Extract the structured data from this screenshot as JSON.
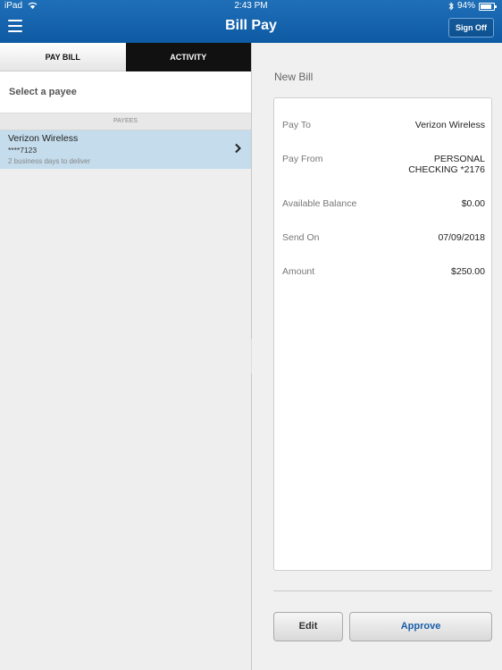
{
  "status_bar": {
    "device": "iPad",
    "time": "2:43 PM",
    "battery": "94%"
  },
  "header": {
    "title": "Bill Pay",
    "sign_off_label": "Sign Off"
  },
  "left_pane": {
    "tabs": [
      {
        "label": "PAY BILL"
      },
      {
        "label": "ACTIVITY"
      }
    ],
    "select_payee": "Select a payee",
    "payees_header": "PAYEES",
    "payees": [
      {
        "name": "Verizon Wireless",
        "account": "****7123",
        "delivery": "2 business days to deliver"
      }
    ]
  },
  "right_pane": {
    "title": "New Bill",
    "fields": [
      {
        "label": "Pay To",
        "value": "Verizon Wireless"
      },
      {
        "label": "Pay From",
        "value": "PERSONAL CHECKING *2176"
      },
      {
        "label": "Available Balance",
        "value": "$0.00"
      },
      {
        "label": "Send On",
        "value": "07/09/2018"
      },
      {
        "label": "Amount",
        "value": "$250.00"
      }
    ],
    "edit_label": "Edit",
    "approve_label": "Approve"
  },
  "colors": {
    "header_blue": "#0e5aa3",
    "selected_row": "#c4dcec",
    "approve_text": "#1a5ea8"
  }
}
